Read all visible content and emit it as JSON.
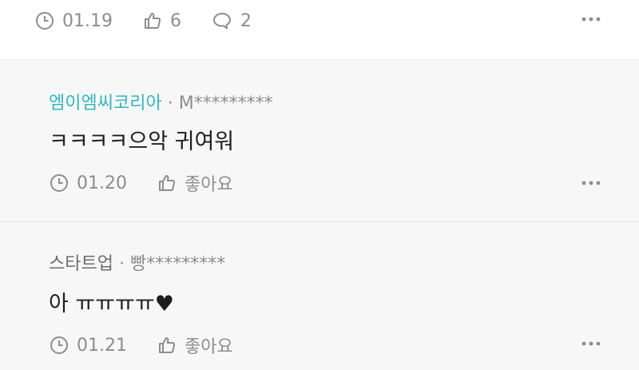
{
  "top_comment": {
    "date": "01.19",
    "likes": "6",
    "replies": "2"
  },
  "replies": [
    {
      "author": "엠이엠씨코리아",
      "separator": "·",
      "handle": "M*********",
      "text": "ㅋㅋㅋㅋ으악 귀여워",
      "date": "01.20",
      "like_label": "좋아요",
      "author_color": "#33b5bd"
    },
    {
      "author": "스타트업",
      "separator": "·",
      "handle": "빵*********",
      "text": "아 ㅠㅠㅠㅠ♥",
      "date": "01.21",
      "like_label": "좋아요",
      "author_color": "#6d6d6d"
    }
  ],
  "icons": {
    "clock": "clock-icon",
    "like": "thumbs-up-icon",
    "comment": "speech-bubble-icon",
    "more": "more-icon"
  }
}
